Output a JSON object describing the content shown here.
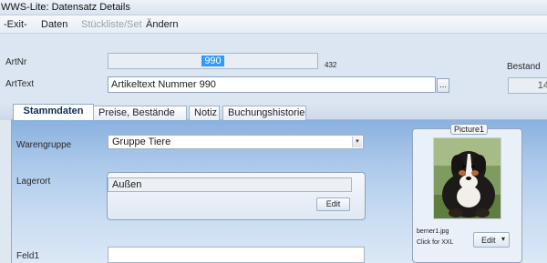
{
  "window": {
    "title": "WWS-Lite: Datensatz Details"
  },
  "menu": {
    "items": [
      {
        "label": "-Exit-",
        "enabled": true
      },
      {
        "label": "Daten",
        "enabled": true
      },
      {
        "label": "Stückliste/Set",
        "enabled": false
      },
      {
        "label": "Ändern",
        "enabled": true
      }
    ]
  },
  "header": {
    "artnr_label": "ArtNr",
    "artnr_value": "990",
    "artnr_extra": "432",
    "arttext_label": "ArtText",
    "arttext_value": "Artikeltext Nummer 990",
    "ellipsis_label": "...",
    "bestand_label": "Bestand",
    "bestand_value": "14"
  },
  "tabs": [
    {
      "label": "Stammdaten",
      "active": true
    },
    {
      "label": "Preise, Bestände etc",
      "active": false
    },
    {
      "label": "Notiz",
      "active": false
    },
    {
      "label": "Buchungshistorie",
      "active": false
    }
  ],
  "stammdaten": {
    "warengruppe_label": "Warengruppe",
    "warengruppe_value": "Gruppe Tiere",
    "lagerort_label": "Lagerort",
    "lagerort_value": "Außen",
    "lagerort_edit_label": "Edit",
    "feld1_label": "Feld1",
    "feld1_value": ""
  },
  "picture": {
    "title": "Picture1",
    "filename": "berner1.jpg",
    "hint": "Click for XXL",
    "edit_label": "Edit",
    "dropdown_glyph": "▾"
  },
  "colors": {
    "panel_top": "#8ab1df",
    "panel_bottom": "#dce8f6",
    "selection": "#3399ff"
  },
  "icons": {
    "combo_arrow": "chevron-down-icon",
    "photo": "dog-photo"
  }
}
